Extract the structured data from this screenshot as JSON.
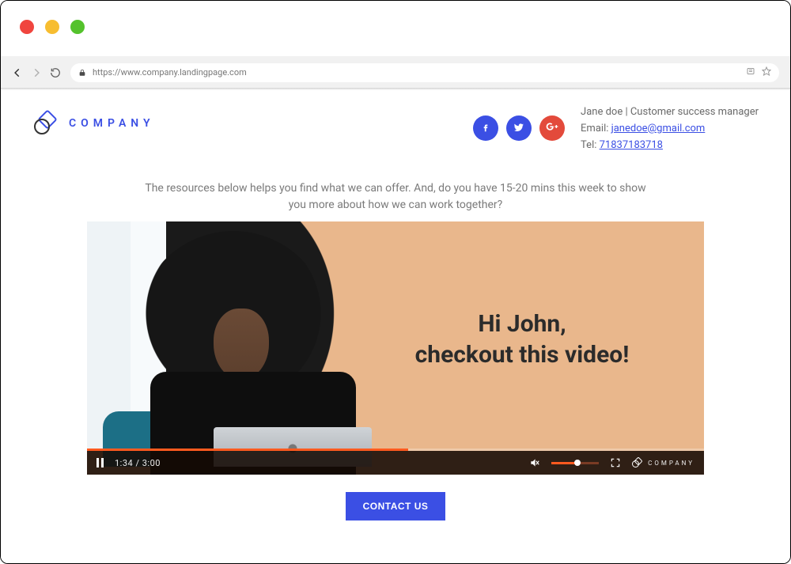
{
  "browser": {
    "url": "https://www.company.landingpage.com"
  },
  "brand": {
    "name": "COMPANY"
  },
  "contact": {
    "name_role": "Jane doe | Customer success manager",
    "email_label": "Email: ",
    "email": "janedoe@gmail.com",
    "tel_label": "Tel: ",
    "tel": "71837183718"
  },
  "intro": "The resources below helps you find what we can offer. And, do you have 15-20 mins this week to show you more about how we can work together?",
  "video": {
    "overlay_line1": "Hi John,",
    "overlay_line2": "checkout this video!",
    "current_time": "1:34",
    "duration": "3:00",
    "brand_mark": "COMPANY"
  },
  "cta": {
    "label": "CONTACT US"
  }
}
